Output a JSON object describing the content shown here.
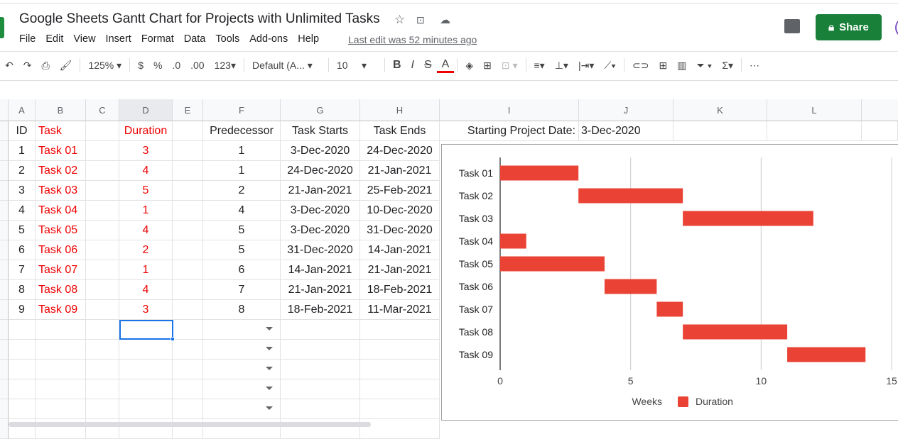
{
  "doc": {
    "title": "Google Sheets Gantt Chart for Projects with Unlimited Tasks",
    "last_edit": "Last edit was 52 minutes ago",
    "share_label": "Share"
  },
  "menu": [
    "File",
    "Edit",
    "View",
    "Insert",
    "Format",
    "Data",
    "Tools",
    "Add-ons",
    "Help"
  ],
  "toolbar": {
    "zoom": "125%",
    "currency": "$",
    "percent": "%",
    "dec_less": ".0",
    "dec_more": ".00",
    "format_more": "123",
    "font": "Default (A...",
    "font_size": "10",
    "bold": "B",
    "italic": "I",
    "strike": "S",
    "text_color": "A",
    "more": "⋯"
  },
  "columns": [
    "A",
    "B",
    "C",
    "D",
    "E",
    "F",
    "G",
    "H",
    "I",
    "J",
    "K",
    "L"
  ],
  "headers": {
    "id": "ID",
    "task": "Task",
    "duration": "Duration",
    "predecessor": "Predecessor",
    "starts": "Task Starts",
    "ends": "Task Ends",
    "start_label": "Starting Project Date:",
    "start_date": "3-Dec-2020"
  },
  "rows": [
    {
      "id": "1",
      "task": "Task 01",
      "duration": "3",
      "pred": "1",
      "start": "3-Dec-2020",
      "end": "24-Dec-2020"
    },
    {
      "id": "2",
      "task": "Task 02",
      "duration": "4",
      "pred": "1",
      "start": "24-Dec-2020",
      "end": "21-Jan-2021"
    },
    {
      "id": "3",
      "task": "Task 03",
      "duration": "5",
      "pred": "2",
      "start": "21-Jan-2021",
      "end": "25-Feb-2021"
    },
    {
      "id": "4",
      "task": "Task 04",
      "duration": "1",
      "pred": "4",
      "start": "3-Dec-2020",
      "end": "10-Dec-2020"
    },
    {
      "id": "5",
      "task": "Task 05",
      "duration": "4",
      "pred": "5",
      "start": "3-Dec-2020",
      "end": "31-Dec-2020"
    },
    {
      "id": "6",
      "task": "Task 06",
      "duration": "2",
      "pred": "5",
      "start": "31-Dec-2020",
      "end": "14-Jan-2021"
    },
    {
      "id": "7",
      "task": "Task 07",
      "duration": "1",
      "pred": "6",
      "start": "14-Jan-2021",
      "end": "21-Jan-2021"
    },
    {
      "id": "8",
      "task": "Task 08",
      "duration": "4",
      "pred": "7",
      "start": "21-Jan-2021",
      "end": "18-Feb-2021"
    },
    {
      "id": "9",
      "task": "Task 09",
      "duration": "3",
      "pred": "8",
      "start": "18-Feb-2021",
      "end": "11-Mar-2021"
    }
  ],
  "chart_data": {
    "type": "bar",
    "orientation": "horizontal",
    "stacked": true,
    "categories": [
      "Task 01",
      "Task 02",
      "Task 03",
      "Task 04",
      "Task 05",
      "Task 06",
      "Task 07",
      "Task 08",
      "Task 09"
    ],
    "series": [
      {
        "name": "Weeks",
        "values": [
          0,
          3,
          7,
          0,
          0,
          4,
          6,
          7,
          11
        ],
        "color": "transparent"
      },
      {
        "name": "Duration",
        "values": [
          3,
          4,
          5,
          1,
          4,
          2,
          1,
          4,
          3
        ],
        "color": "#ea4335"
      }
    ],
    "xlim": [
      0,
      15
    ],
    "xticks": [
      "0",
      "5",
      "10",
      "15"
    ],
    "grid": true,
    "legend": "bottom"
  }
}
